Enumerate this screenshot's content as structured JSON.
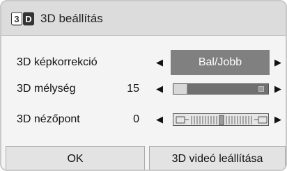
{
  "dialog": {
    "title": "3D beállítás",
    "title_icon": "3d-settings-icon"
  },
  "settings": {
    "correction": {
      "label": "3D képkorrekció",
      "value": "Bal/Jobb",
      "left_arrow": "◀",
      "right_arrow": "▶"
    },
    "depth": {
      "label": "3D mélység",
      "value": "15",
      "level_fraction": 0.15,
      "left_arrow": "◀",
      "right_arrow": "▶"
    },
    "viewpoint": {
      "label": "3D nézőpont",
      "value": "0",
      "left_arrow": "◀",
      "right_arrow": "▶"
    }
  },
  "buttons": {
    "ok": "OK",
    "video_reset": "3D videó leállítása"
  },
  "colors": {
    "selected_bg": "#808080",
    "title_bg": "#dcdcdc",
    "button_bg": "#e3e3e3"
  }
}
